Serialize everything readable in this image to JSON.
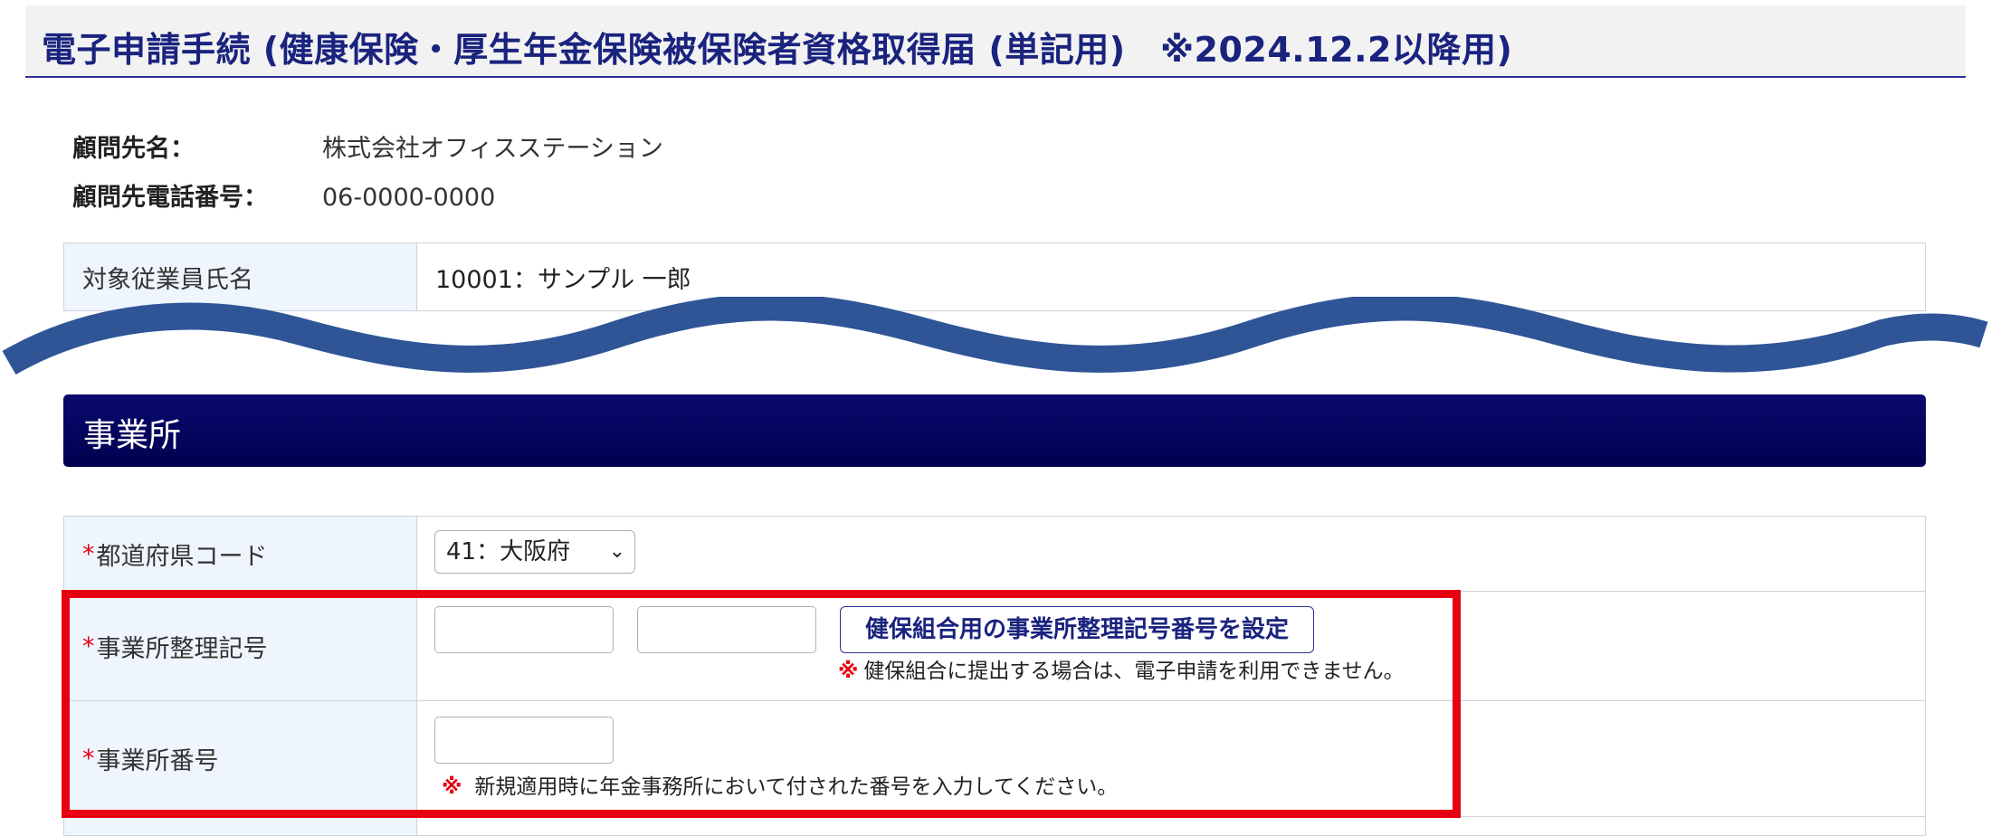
{
  "header": {
    "title": "電子申請手続 (健康保険・厚生年金保険被保険者資格取得届 (単記用)　※2024.12.2以降用)"
  },
  "client": {
    "name_label": "顧問先名：",
    "name_value": "株式会社オフィスステーション",
    "phone_label": "顧問先電話番号：",
    "phone_value": "06-0000-0000"
  },
  "employee": {
    "label": "対象従業員氏名",
    "value": "10001：サンプル 一郎"
  },
  "section": {
    "title": "事業所"
  },
  "form": {
    "required_mark": "*",
    "prefecture": {
      "label": "都道府県コード",
      "selected": "41：大阪府"
    },
    "office_symbol": {
      "label": "事業所整理記号",
      "input1_value": "",
      "input2_value": "",
      "button_label": "健保組合用の事業所整理記号番号を設定",
      "note_mark": "※",
      "note": "健保組合に提出する場合は、電子申請を利用できません。"
    },
    "office_number": {
      "label": "事業所番号",
      "input_value": "",
      "note_mark": "※",
      "note": "新規適用時に年金事務所において付された番号を入力してください。"
    }
  },
  "colors": {
    "accent": "#1a237e",
    "section_bg": "#000050",
    "highlight": "#e60012",
    "wave": "#2f5597"
  }
}
